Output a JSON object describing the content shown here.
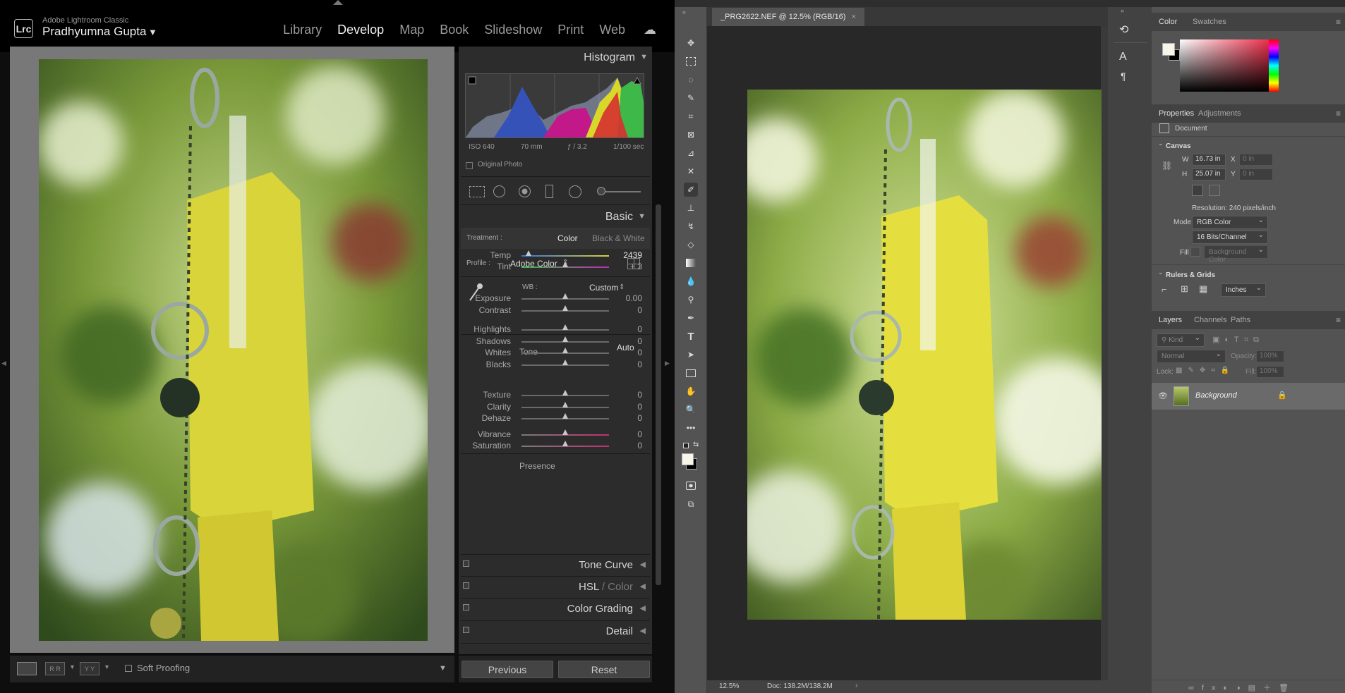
{
  "lightroom": {
    "brand": "Adobe Lightroom Classic",
    "logo": "Lrc",
    "user": "Pradhyumna Gupta",
    "modules": [
      "Library",
      "Develop",
      "Map",
      "Book",
      "Slideshow",
      "Print",
      "Web"
    ],
    "active_module": "Develop",
    "histogram": {
      "title": "Histogram",
      "iso": "ISO 640",
      "focal": "70 mm",
      "aperture": "ƒ / 3.2",
      "shutter": "1/100 sec",
      "original_photo": "Original Photo"
    },
    "basic": {
      "title": "Basic",
      "treatment_label": "Treatment :",
      "treatment_color": "Color",
      "treatment_bw": "Black & White",
      "profile_label": "Profile :",
      "profile_value": "Adobe Color",
      "wb_label": "WB :",
      "wb_value": "Custom",
      "tone_label": "Tone",
      "auto_label": "Auto",
      "presence_label": "Presence",
      "sliders": [
        {
          "label": "Temp",
          "value": "2439",
          "pos": 0.08
        },
        {
          "label": "Tint",
          "value": "+ 3",
          "pos": 0.5
        },
        {
          "label": "Exposure",
          "value": "0.00",
          "pos": 0.5
        },
        {
          "label": "Contrast",
          "value": "0",
          "pos": 0.5
        },
        {
          "label": "Highlights",
          "value": "0",
          "pos": 0.5
        },
        {
          "label": "Shadows",
          "value": "0",
          "pos": 0.5
        },
        {
          "label": "Whites",
          "value": "0",
          "pos": 0.5
        },
        {
          "label": "Blacks",
          "value": "0",
          "pos": 0.5
        },
        {
          "label": "Texture",
          "value": "0",
          "pos": 0.5
        },
        {
          "label": "Clarity",
          "value": "0",
          "pos": 0.5
        },
        {
          "label": "Dehaze",
          "value": "0",
          "pos": 0.5
        },
        {
          "label": "Vibrance",
          "value": "0",
          "pos": 0.5
        },
        {
          "label": "Saturation",
          "value": "0",
          "pos": 0.5
        }
      ]
    },
    "collapsed_panels": [
      "Tone Curve",
      "HSL",
      "Color Grading",
      "Detail"
    ],
    "hsl_secondary": "/ Color",
    "soft_proofing": "Soft Proofing",
    "previous_button": "Previous",
    "reset_button": "Reset",
    "view_yy": "Y Y",
    "view_rr": "R R"
  },
  "photoshop": {
    "doc_tab": "_PRG2622.NEF @ 12.5% (RGB/16)",
    "zoom": "12.5%",
    "doc_size": "Doc: 138.2M/138.2M",
    "color_tabs": [
      "Color",
      "Swatches"
    ],
    "properties_tabs": [
      "Properties",
      "Adjustments"
    ],
    "document_label": "Document",
    "canvas_label": "Canvas",
    "w_label": "W",
    "w_value": "16.73 in",
    "h_label": "H",
    "h_value": "25.07 in",
    "x_label": "X",
    "x_placeholder": "0 in",
    "y_label": "Y",
    "y_placeholder": "0 in",
    "resolution": "Resolution: 240 pixels/inch",
    "mode_label": "Mode",
    "mode_value": "RGB Color",
    "bits_value": "16 Bits/Channel",
    "fill_label": "Fill",
    "fill_value": "Background Color",
    "rulers_label": "Rulers & Grids",
    "units_value": "Inches",
    "layers_tabs": [
      "Layers",
      "Channels",
      "Paths"
    ],
    "kind_placeholder": "Kind",
    "blend_mode": "Normal",
    "opacity_label": "Opacity:",
    "opacity_value": "100%",
    "lock_label": "Lock:",
    "fill2_label": "Fill:",
    "fill2_value": "100%",
    "layer_name": "Background"
  },
  "colors": {
    "accent_yellow": "#d9d43a",
    "lr_panel": "#2c2c2c",
    "ps_panel": "#535353"
  }
}
